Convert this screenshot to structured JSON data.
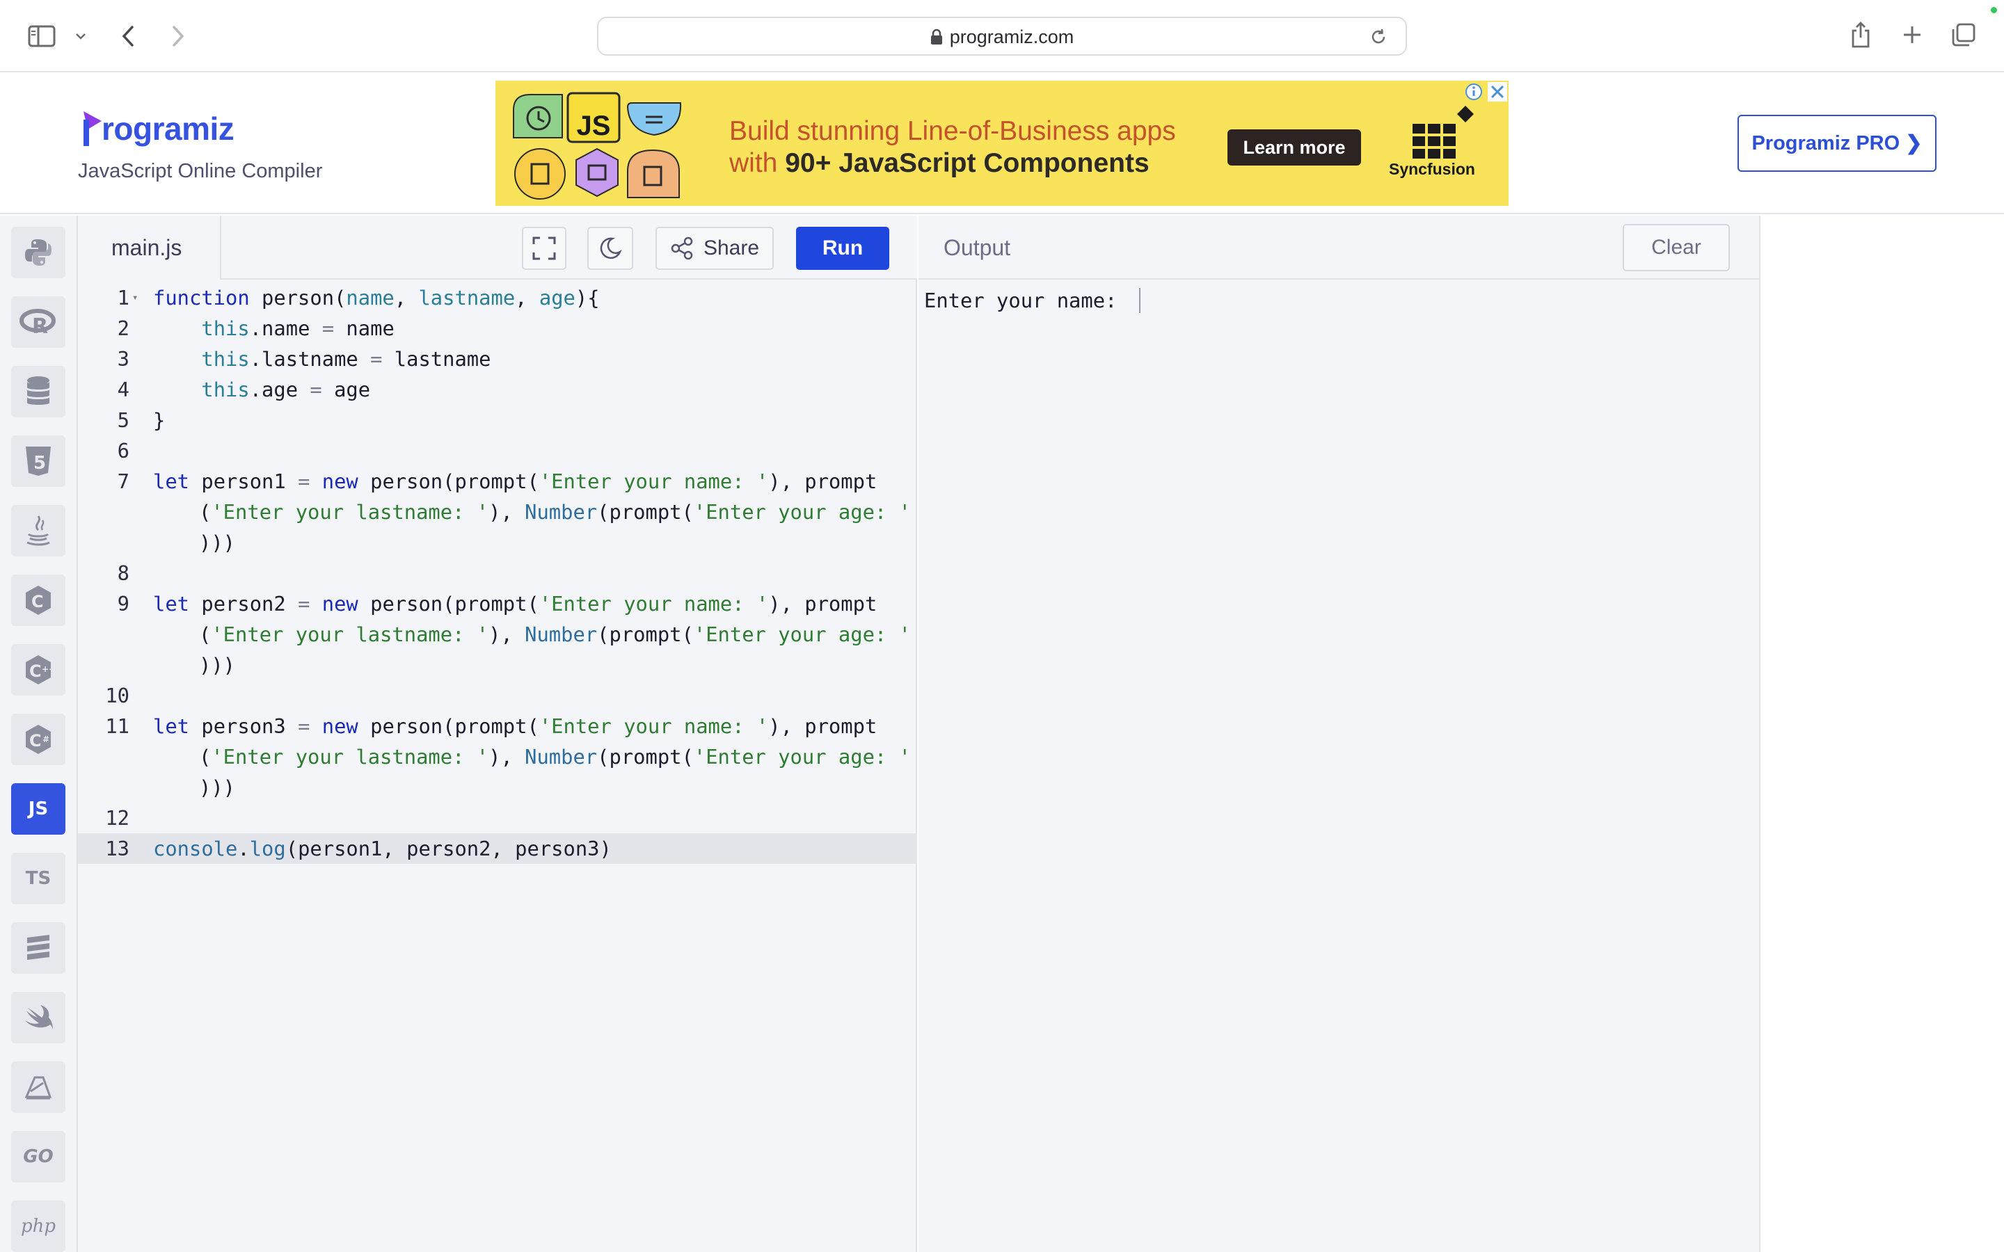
{
  "browser": {
    "url": "programiz.com"
  },
  "header": {
    "logo_text": "rogramiz",
    "subtitle": "JavaScript Online Compiler",
    "pro_button": "Programiz PRO ❯"
  },
  "ad": {
    "line1": "Build stunning Line-of-Business apps",
    "line2_prefix": "with",
    "line2_bold": "90+ JavaScript Components",
    "cta": "Learn more",
    "brand": "Syncfusion",
    "tile_label": "JS"
  },
  "languages": [
    {
      "name": "python",
      "label": ""
    },
    {
      "name": "r",
      "label": "R"
    },
    {
      "name": "sql",
      "label": ""
    },
    {
      "name": "html",
      "label": "5"
    },
    {
      "name": "java",
      "label": ""
    },
    {
      "name": "c",
      "label": "C"
    },
    {
      "name": "cpp",
      "label": "C"
    },
    {
      "name": "csharp",
      "label": "C"
    },
    {
      "name": "javascript",
      "label": "JS",
      "active": true
    },
    {
      "name": "typescript",
      "label": "TS"
    },
    {
      "name": "sql-db",
      "label": ""
    },
    {
      "name": "swift",
      "label": ""
    },
    {
      "name": "rust",
      "label": ""
    },
    {
      "name": "go",
      "label": "GO"
    },
    {
      "name": "php",
      "label": "php"
    }
  ],
  "editor": {
    "file_name": "main.js",
    "share_label": "Share",
    "run_label": "Run",
    "line_numbers": [
      "1",
      "2",
      "3",
      "4",
      "5",
      "6",
      "7",
      "8",
      "9",
      "10",
      "11",
      "12",
      "13"
    ]
  },
  "output": {
    "title": "Output",
    "clear_label": "Clear",
    "terminal": "Enter your name: "
  }
}
